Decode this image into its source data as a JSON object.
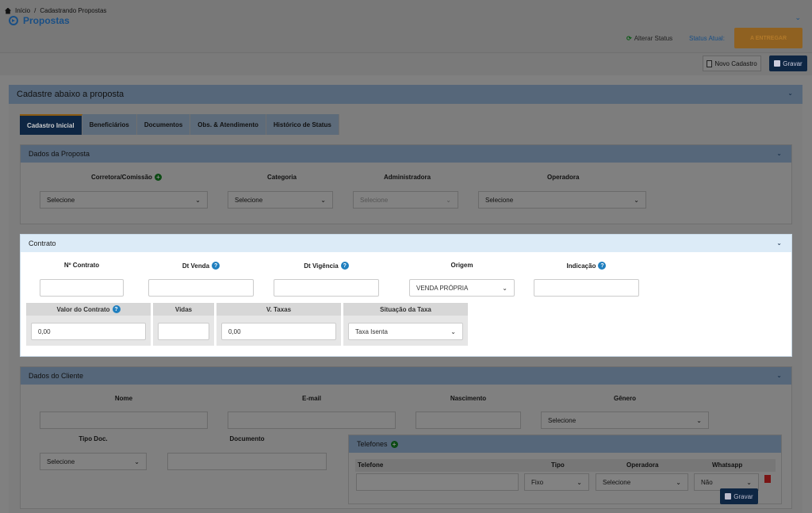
{
  "header": {
    "title": "Propostas",
    "alterar_status": "Alterar Status",
    "status_atual_label": "Status Atual:",
    "status_button": "A ENTREGAR"
  },
  "breadcrumb": {
    "home": "Início",
    "separator": "/",
    "current": "Cadastrando Propostas"
  },
  "toolbar": {
    "novo_cadastro": "Novo Cadastro",
    "gravar": "Gravar"
  },
  "main": {
    "title": "Cadastre abaixo a proposta",
    "tabs": [
      {
        "label": "Cadastro Inicial",
        "active": true
      },
      {
        "label": "Beneficiários",
        "active": false
      },
      {
        "label": "Documentos",
        "active": false
      },
      {
        "label": "Obs. & Atendimento",
        "active": false
      },
      {
        "label": "Histórico de Status",
        "active": false
      }
    ]
  },
  "dados_proposta": {
    "title": "Dados da Proposta",
    "fields": [
      {
        "label": "Corretora/Comissão",
        "value": "Selecione"
      },
      {
        "label": "Categoria",
        "value": "Selecione"
      },
      {
        "label": "Administradora",
        "value": "Selecione"
      },
      {
        "label": "Operadora",
        "value": "Selecione"
      }
    ]
  },
  "contrato": {
    "title": "Contrato",
    "row1": [
      {
        "label": "Nº Contrato",
        "value": ""
      },
      {
        "label": "Dt Venda",
        "value": ""
      },
      {
        "label": "Dt Vigência",
        "value": ""
      },
      {
        "label": "Origem",
        "value": "VENDA PRÓPRIA"
      },
      {
        "label": "Indicação",
        "value": ""
      }
    ],
    "row2": [
      {
        "label": "Valor do Contrato",
        "value": "0,00"
      },
      {
        "label": "Vidas",
        "value": ""
      },
      {
        "label": "V. Taxas",
        "value": "0,00"
      },
      {
        "label": "Situação da Taxa",
        "value": "Taxa Isenta"
      }
    ]
  },
  "dados_cliente": {
    "title": "Dados do Cliente",
    "row1": [
      {
        "label": "Nome",
        "value": ""
      },
      {
        "label": "E-mail",
        "value": ""
      },
      {
        "label": "Nascimento",
        "value": ""
      },
      {
        "label": "Gênero",
        "value": "Selecione"
      }
    ],
    "row2": [
      {
        "label": "Tipo Doc.",
        "value": "Selecione"
      },
      {
        "label": "Documento",
        "value": ""
      }
    ]
  },
  "telefones": {
    "title": "Telefones",
    "columns": [
      "Telefone",
      "Tipo",
      "Operadora",
      "Whatsapp"
    ],
    "row": {
      "telefone": "",
      "tipo": "Fixo",
      "operadora": "Selecione",
      "whatsapp": "Não"
    }
  },
  "footer": {
    "gravar": "Gravar"
  }
}
